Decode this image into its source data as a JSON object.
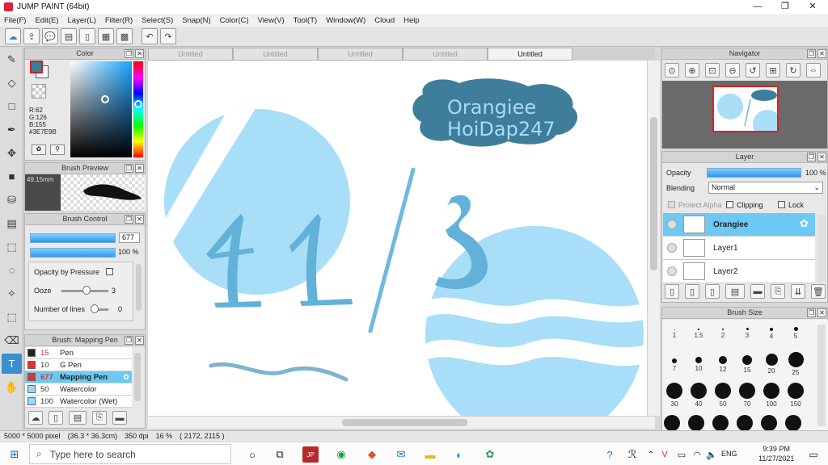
{
  "window": {
    "title": "JUMP PAINT (64bit)",
    "minimize": "—",
    "restore": "❐",
    "close": "✕"
  },
  "menu": [
    "File(F)",
    "Edit(E)",
    "Layer(L)",
    "Filter(R)",
    "Select(S)",
    "Snap(N)",
    "Color(C)",
    "View(V)",
    "Tool(T)",
    "Window(W)",
    "Cloud",
    "Help"
  ],
  "color_panel": {
    "title": "Color",
    "r": "R:62",
    "g": "G:126",
    "b": "B:155",
    "hex": "#3E7E9B",
    "main_color": "#3E7E9B"
  },
  "brush_preview": {
    "title": "Brush Preview",
    "size": "49.15mm"
  },
  "brush_control": {
    "title": "Brush Control",
    "size_value": "677",
    "opacity_value": "100 %",
    "opacity_by_pressure": "Opacity by Pressure",
    "ooze_label": "Ooze",
    "ooze_value": "3",
    "lines_label": "Number of lines",
    "lines_value": "0"
  },
  "brush_list": {
    "title": "Brush: Mapping Pen",
    "items": [
      {
        "num": "15",
        "name": "Pen",
        "color": "#222222"
      },
      {
        "num": "10",
        "name": "G Pen",
        "color": "#e53030"
      },
      {
        "num": "677",
        "name": "Mapping Pen",
        "color": "#e53030"
      },
      {
        "num": "50",
        "name": "Watercolor",
        "color": "#8fe0ff"
      },
      {
        "num": "100",
        "name": "Watercolor (Wet)",
        "color": "#8fe0ff"
      }
    ]
  },
  "tabs": [
    "Untitled",
    "Untitled",
    "Untitled",
    "Untitled",
    "Untitled"
  ],
  "canvas": {
    "badge_line1": "Orangiee",
    "badge_line2": "HoiDap247"
  },
  "navigator": {
    "title": "Navigator"
  },
  "layer_panel": {
    "title": "Layer",
    "opacity_label": "Opacity",
    "opacity_value": "100 %",
    "blending_label": "Blending",
    "blending_value": "Normal",
    "protect_alpha": "Protect Alpha",
    "clipping": "Clipping",
    "lock": "Lock",
    "layers": [
      "Orangiee",
      "Layer1",
      "Layer2"
    ]
  },
  "brush_size": {
    "title": "Brush Size",
    "sizes": [
      "1",
      "1.5",
      "2",
      "3",
      "4",
      "5",
      "7",
      "10",
      "12",
      "15",
      "20",
      "25",
      "30",
      "40",
      "50",
      "70",
      "100",
      "150"
    ]
  },
  "status": {
    "pixels": "5000 * 5000 pixel",
    "size_cm": "(36.3 * 36.3cm)",
    "dpi": "350 dpi",
    "zoom": "16 %",
    "coords": "( 2172, 2115 )"
  },
  "taskbar": {
    "search_placeholder": "Type here to search",
    "lang": "ENG",
    "time": "9:39 PM",
    "date": "11/27/2021"
  }
}
